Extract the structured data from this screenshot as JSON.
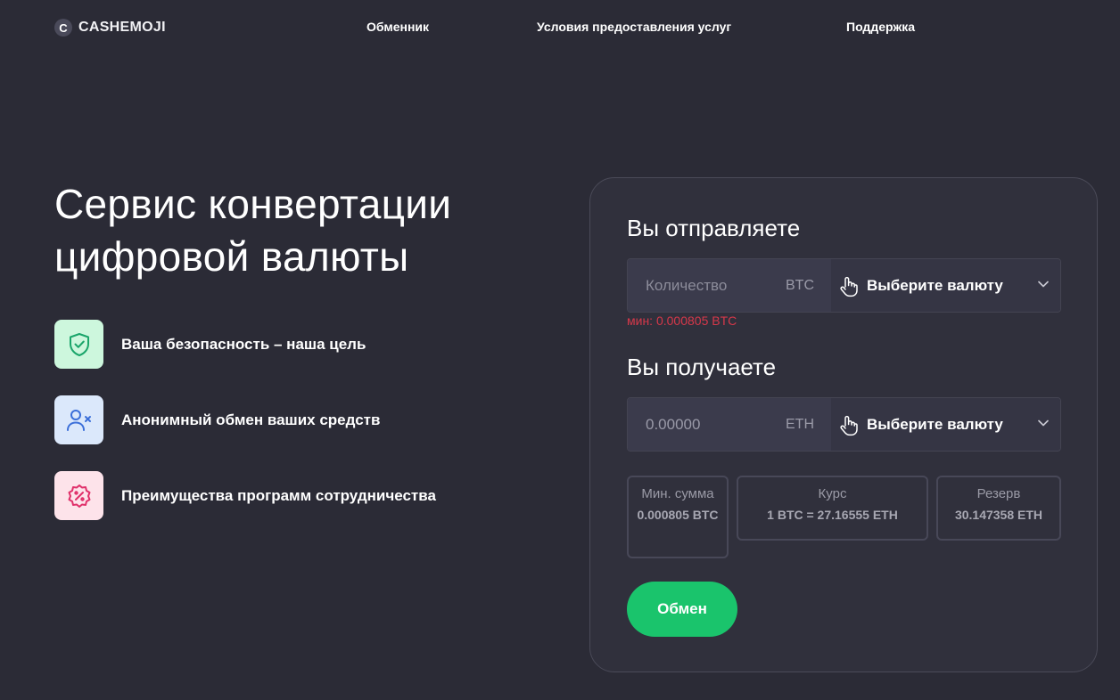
{
  "brand": {
    "name": "CASHEMOJI",
    "mark": "C"
  },
  "nav": {
    "items": [
      "Обменник",
      "Условия предоставления услуг",
      "Поддержка"
    ]
  },
  "hero": {
    "title_line1": "Сервис конвертации",
    "title_line2": "цифровой валюты",
    "features": [
      {
        "text": "Ваша безопасность – наша цель",
        "icon": "shield-check-icon",
        "color": "#1aa56a"
      },
      {
        "text": "Анонимный обмен ваших средств",
        "icon": "user-x-icon",
        "color": "#3b6fd9"
      },
      {
        "text": "Преимущества программ сотрудничества",
        "icon": "percent-badge-icon",
        "color": "#e0306a"
      }
    ]
  },
  "exchange": {
    "send": {
      "title": "Вы отправляете",
      "placeholder": "Количество",
      "unit": "BTC",
      "select_label": "Выберите валюту",
      "min_note": "мин: 0.000805 BTC"
    },
    "receive": {
      "title": "Вы получаете",
      "value": "0.00000",
      "unit": "ETH",
      "select_label": "Выберите валюту"
    },
    "info": {
      "min_label": "Мин. сумма",
      "min_value": "0.000805 BTC",
      "rate_label": "Курс",
      "rate_value": "1 BTC = 27.16555 ETH",
      "reserve_label": "Резерв",
      "reserve_value": "30.147358 ETH"
    },
    "button_label": "Обмен",
    "accent_color": "#1ac46c",
    "error_color": "#d6384a"
  }
}
